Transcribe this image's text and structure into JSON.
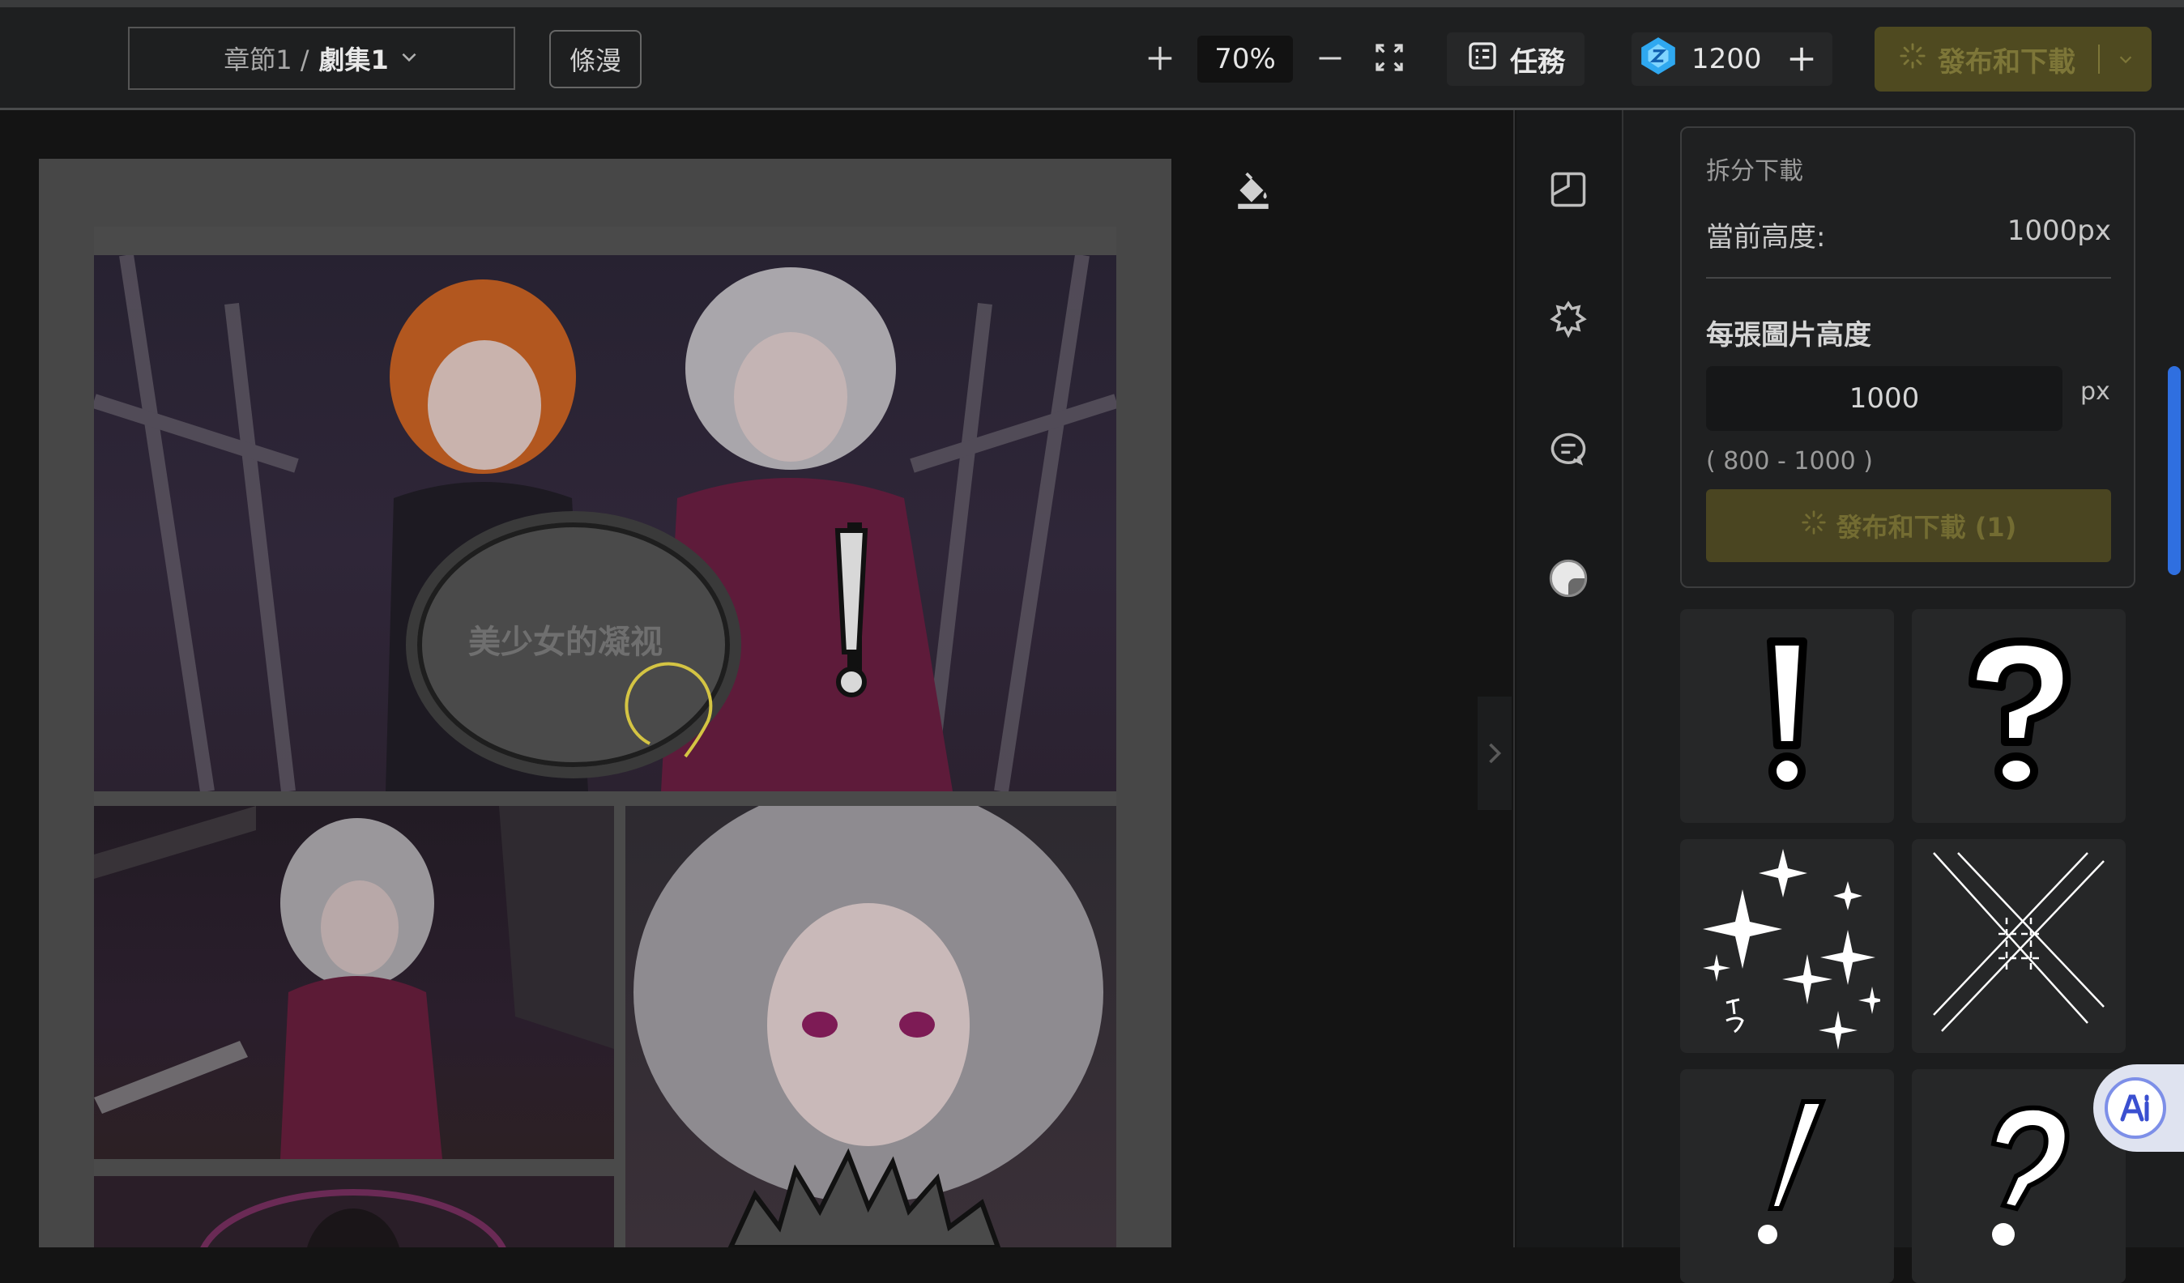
{
  "header": {
    "chapter_prefix": "章節1 /",
    "chapter_episode": "劇集1",
    "comic_mode_label": "條漫",
    "zoom_level": "70%",
    "tasks_label": "任務",
    "credits_value": "1200",
    "publish_download_label": "發布和下載"
  },
  "canvas": {
    "bubble_text": "美少女的凝视"
  },
  "right_panel": {
    "split_download": {
      "title": "拆分下載",
      "current_height_label": "當前高度:",
      "current_height_value": "1000px",
      "image_height_label": "每張圖片高度",
      "image_height_value": "1000",
      "unit": "px",
      "range_hint": "( 800 - 1000 )",
      "publish_button_label": "發布和下載 (1)"
    }
  },
  "colors": {
    "accent_yellow": "#4f4a20",
    "accent_text": "#7d7638",
    "scroll_blue": "#2f6fe0",
    "background": "#141414"
  },
  "icons": [
    "chevron-down-icon",
    "plus-icon",
    "minus-icon",
    "fullscreen-icon",
    "tasks-icon",
    "gem-icon",
    "loading-spinner-icon",
    "paint-bucket-icon",
    "panel-layout-icon",
    "burst-bubble-icon",
    "chat-bubble-icon",
    "sticker-icon",
    "collapse-arrow-icon",
    "ai-assistant-icon"
  ],
  "stickers": [
    "exclamation",
    "question",
    "sparkles",
    "speed-lines",
    "exclamation-thin",
    "question-thin"
  ]
}
